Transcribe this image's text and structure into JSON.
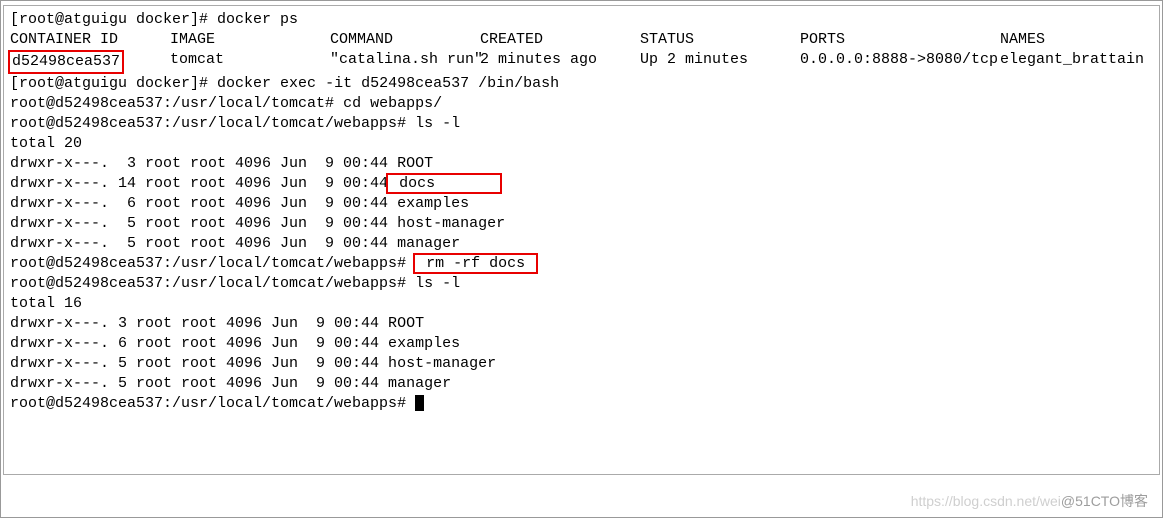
{
  "prompt1": "[root@atguigu docker]# ",
  "cmd_ps": "docker ps",
  "ps_headers": {
    "container_id": "CONTAINER ID",
    "image": "IMAGE",
    "command": "COMMAND",
    "created": "CREATED",
    "status": "STATUS",
    "ports": "PORTS",
    "names": "NAMES"
  },
  "ps_row": {
    "container_id": "d52498cea537",
    "image": "tomcat",
    "command": "\"catalina.sh run\"",
    "created": "2 minutes ago",
    "status": "Up 2 minutes",
    "ports": "0.0.0.0:8888->8080/tcp",
    "names": "elegant_brattain"
  },
  "cmd_exec": "docker exec -it d52498cea537 /bin/bash",
  "prompt_tomcat": "root@d52498cea537:/usr/local/tomcat# ",
  "cmd_cd": "cd webapps/",
  "prompt_webapps": "root@d52498cea537:/usr/local/tomcat/webapps# ",
  "cmd_ls": "ls -l",
  "total1": "total 20",
  "ls1": [
    {
      "perm": "drwxr-x---.",
      "links": " 3",
      "owner": "root",
      "group": "root",
      "size": "4096",
      "date": "Jun  9 00:44",
      "name": "ROOT",
      "boxed": false
    },
    {
      "perm": "drwxr-x---.",
      "links": "14",
      "owner": "root",
      "group": "root",
      "size": "4096",
      "date": "Jun  9 00:44",
      "name": " docs",
      "boxed": true
    },
    {
      "perm": "drwxr-x---.",
      "links": " 6",
      "owner": "root",
      "group": "root",
      "size": "4096",
      "date": "Jun  9 00:44",
      "name": "examples",
      "boxed": false
    },
    {
      "perm": "drwxr-x---.",
      "links": " 5",
      "owner": "root",
      "group": "root",
      "size": "4096",
      "date": "Jun  9 00:44",
      "name": "host-manager",
      "boxed": false
    },
    {
      "perm": "drwxr-x---.",
      "links": " 5",
      "owner": "root",
      "group": "root",
      "size": "4096",
      "date": "Jun  9 00:44",
      "name": "manager",
      "boxed": false
    }
  ],
  "cmd_rm": " rm -rf docs ",
  "total2": "total 16",
  "ls2": [
    {
      "perm": "drwxr-x---.",
      "links": "3",
      "owner": "root",
      "group": "root",
      "size": "4096",
      "date": "Jun  9 00:44",
      "name": "ROOT"
    },
    {
      "perm": "drwxr-x---.",
      "links": "6",
      "owner": "root",
      "group": "root",
      "size": "4096",
      "date": "Jun  9 00:44",
      "name": "examples"
    },
    {
      "perm": "drwxr-x---.",
      "links": "5",
      "owner": "root",
      "group": "root",
      "size": "4096",
      "date": "Jun  9 00:44",
      "name": "host-manager"
    },
    {
      "perm": "drwxr-x---.",
      "links": "5",
      "owner": "root",
      "group": "root",
      "size": "4096",
      "date": "Jun  9 00:44",
      "name": "manager"
    }
  ],
  "watermark": {
    "site": "https://blog.csdn.net/wei",
    "author": "@51CTO博客"
  }
}
